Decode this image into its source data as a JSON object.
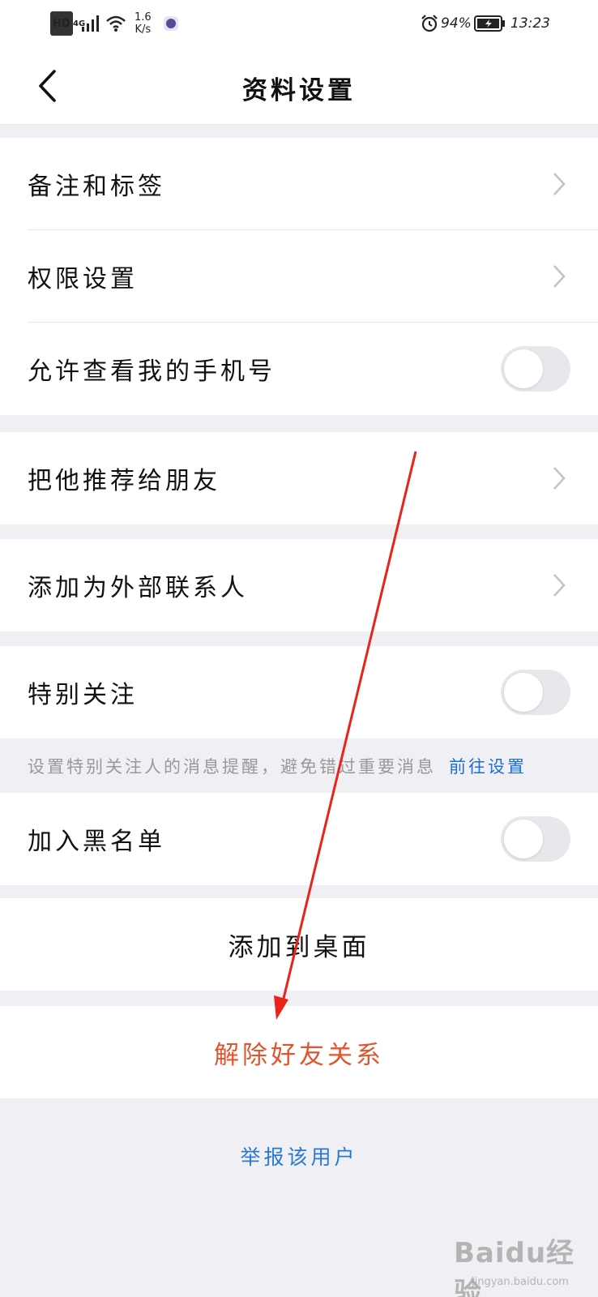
{
  "status_bar": {
    "hd": "HD",
    "network": "4G",
    "speed_value": "1.6",
    "speed_unit": "K/s",
    "battery": "94%",
    "time": "13:23"
  },
  "header": {
    "title": "资料设置"
  },
  "settings": {
    "remark_tags": "备注和标签",
    "permissions": "权限设置",
    "allow_view_phone": "允许查看我的手机号",
    "recommend_to_friend": "把他推荐给朋友",
    "add_external_contact": "添加为外部联系人",
    "special_attention": "特别关注",
    "special_hint": "设置特别关注人的消息提醒，避免错过重要消息",
    "special_hint_link": "前往设置",
    "blacklist": "加入黑名单",
    "add_to_desktop": "添加到桌面",
    "remove_friend": "解除好友关系",
    "report_user": "举报该用户"
  },
  "toggles": {
    "allow_view_phone_on": false,
    "special_attention_on": false,
    "blacklist_on": false
  },
  "colors": {
    "danger": "#e0552d",
    "link": "#2b78d0",
    "annotation_arrow": "#e8231a"
  },
  "watermark": {
    "brand": "Baidu经验",
    "url": "jingyan.baidu.com"
  }
}
